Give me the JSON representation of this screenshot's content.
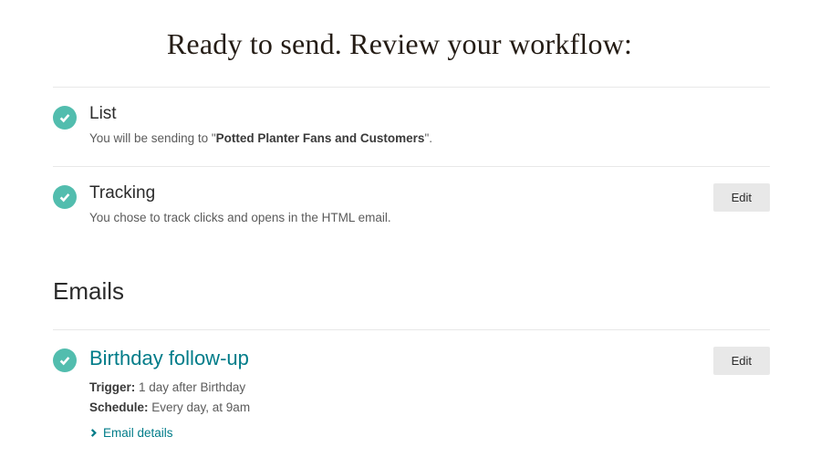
{
  "page_title": "Ready to send. Review your workflow:",
  "sections": {
    "list": {
      "heading": "List",
      "desc_prefix": "You will be sending to \"",
      "desc_bold": "Potted Planter Fans and Customers",
      "desc_suffix": "\"."
    },
    "tracking": {
      "heading": "Tracking",
      "desc": "You chose to track clicks and opens in the HTML email.",
      "edit_label": "Edit"
    }
  },
  "emails_heading": "Emails",
  "emails": [
    {
      "title": "Birthday follow-up",
      "trigger_label": "Trigger:",
      "trigger_value": " 1 day after Birthday",
      "schedule_label": "Schedule:",
      "schedule_value": " Every day, at 9am",
      "details_label": "Email details",
      "edit_label": "Edit"
    }
  ]
}
